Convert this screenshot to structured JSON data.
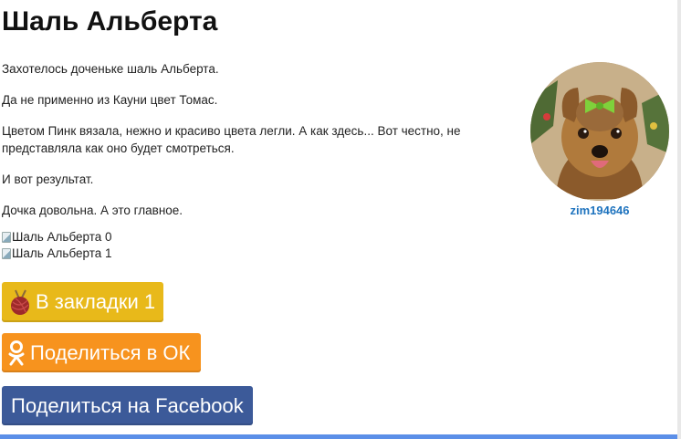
{
  "post": {
    "title": "Шаль Альберта",
    "paragraphs": [
      "Захотелось доченьке шаль Альберта.",
      "Да не применно из Кауни цвет Томас.",
      "Цветом Пинк вязала, нежно и красиво цвета легли. А как здесь... Вот честно, не представляла как оно будет смотреться.",
      "И вот результат.",
      "Дочка довольна. А это главное."
    ],
    "images": [
      "Шаль Альберта 0",
      "Шаль Альберта 1"
    ]
  },
  "author": {
    "username": "zim194646",
    "avatar_icon": "yorkshire-terrier-avatar"
  },
  "buttons": {
    "bookmark_label": "В закладки 1",
    "share_ok_label": "Поделиться в ОК",
    "share_facebook_label": "Поделиться на Facebook"
  },
  "colors": {
    "bookmark": "#e8b91a",
    "ok": "#f7931e",
    "facebook": "#3c5a99",
    "link": "#1e73be",
    "bottom_bar": "#5b8fe8"
  }
}
